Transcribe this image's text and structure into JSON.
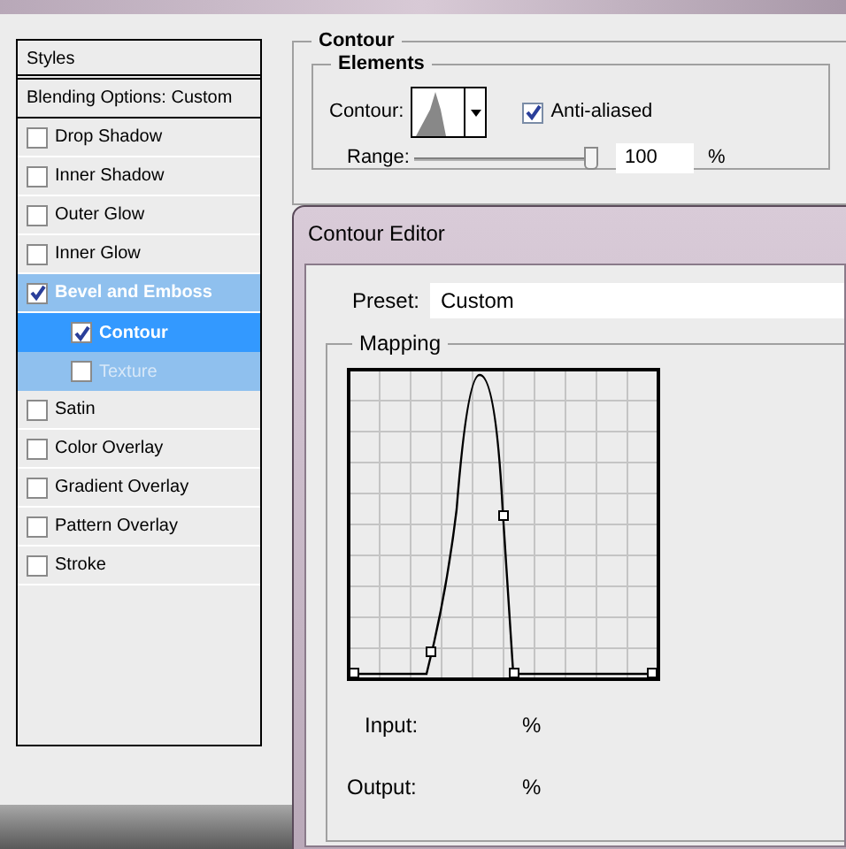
{
  "styles_panel": {
    "header": "Styles",
    "blending_options": "Blending Options: Custom",
    "items": [
      {
        "label": "Drop Shadow",
        "checked": false,
        "expanded": false
      },
      {
        "label": "Inner Shadow",
        "checked": false,
        "expanded": false
      },
      {
        "label": "Outer Glow",
        "checked": false,
        "expanded": false
      },
      {
        "label": "Inner Glow",
        "checked": false,
        "expanded": false
      },
      {
        "label": "Bevel and Emboss",
        "checked": true,
        "expanded": true,
        "children": [
          {
            "label": "Contour",
            "checked": true,
            "selected": true,
            "disabled": false
          },
          {
            "label": "Texture",
            "checked": false,
            "selected": false,
            "disabled": true
          }
        ]
      },
      {
        "label": "Satin",
        "checked": false,
        "expanded": false
      },
      {
        "label": "Color Overlay",
        "checked": false,
        "expanded": false
      },
      {
        "label": "Gradient Overlay",
        "checked": false,
        "expanded": false
      },
      {
        "label": "Pattern Overlay",
        "checked": false,
        "expanded": false
      },
      {
        "label": "Stroke",
        "checked": false,
        "expanded": false
      }
    ]
  },
  "contour_section": {
    "title": "Contour",
    "group": "Elements",
    "contour_label": "Contour:",
    "anti_aliased": {
      "label": "Anti-aliased",
      "checked": true
    },
    "range": {
      "label": "Range:",
      "level": 1.0,
      "value": "100",
      "unit": "%"
    }
  },
  "contour_editor": {
    "title": "Contour Editor",
    "preset": {
      "label": "Preset:",
      "value": "Custom"
    },
    "mapping": {
      "title": "Mapping"
    },
    "input": {
      "label": "Input:",
      "unit": "%"
    },
    "output": {
      "label": "Output:",
      "unit": "%"
    }
  }
}
